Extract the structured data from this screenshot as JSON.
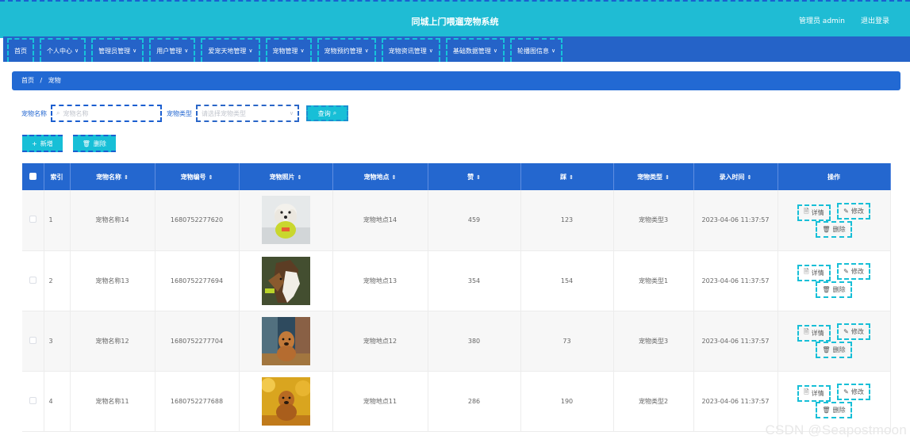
{
  "header": {
    "title": "同城上门喂遛宠物系统",
    "user": "管理员 admin",
    "logout": "退出登录"
  },
  "nav": [
    {
      "label": "首页",
      "has_dropdown": false
    },
    {
      "label": "个人中心",
      "has_dropdown": true
    },
    {
      "label": "管理员管理",
      "has_dropdown": true
    },
    {
      "label": "用户管理",
      "has_dropdown": true
    },
    {
      "label": "爱宠天地管理",
      "has_dropdown": true
    },
    {
      "label": "宠物管理",
      "has_dropdown": true
    },
    {
      "label": "宠物预约管理",
      "has_dropdown": true
    },
    {
      "label": "宠物资讯管理",
      "has_dropdown": true
    },
    {
      "label": "基础数据管理",
      "has_dropdown": true
    },
    {
      "label": "轮播图信息",
      "has_dropdown": true
    }
  ],
  "breadcrumb": {
    "home": "首页",
    "separator": "/",
    "current": "宠物"
  },
  "search": {
    "name_label": "宠物名称",
    "name_placeholder": "宠物名称",
    "type_label": "宠物类型",
    "type_placeholder": "请选择宠物类型",
    "query_label": "查询"
  },
  "actions": {
    "add_label": "新增",
    "delete_label": "删除"
  },
  "table": {
    "headers": {
      "index": "索引",
      "name": "宠物名称",
      "code": "宠物编号",
      "photo": "宠物照片",
      "location": "宠物地点",
      "likes": "赞",
      "dislikes": "踩",
      "type": "宠物类型",
      "time": "录入时间",
      "ops": "操作"
    },
    "rows": [
      {
        "index": "1",
        "name": "宠物名称14",
        "code": "1680752277620",
        "location": "宠物地点14",
        "likes": "459",
        "dislikes": "123",
        "type": "宠物类型3",
        "time": "2023-04-06 11:37:57",
        "photo": "white-dog-photo"
      },
      {
        "index": "2",
        "name": "宠物名称13",
        "code": "1680752277694",
        "location": "宠物地点13",
        "likes": "354",
        "dislikes": "154",
        "type": "宠物类型1",
        "time": "2023-04-06 11:37:57",
        "photo": "collie-dog-photo"
      },
      {
        "index": "3",
        "name": "宠物名称12",
        "code": "1680752277704",
        "location": "宠物地点12",
        "likes": "380",
        "dislikes": "73",
        "type": "宠物类型3",
        "time": "2023-04-06 11:37:57",
        "photo": "brown-dog-photo"
      },
      {
        "index": "4",
        "name": "宠物名称11",
        "code": "1680752277688",
        "location": "宠物地点11",
        "likes": "286",
        "dislikes": "190",
        "type": "宠物类型2",
        "time": "2023-04-06 11:37:57",
        "photo": "golden-dog-photo"
      }
    ],
    "row_actions": {
      "detail": "详情",
      "edit": "修改",
      "delete": "删除"
    }
  },
  "watermark": "CSDN @Seapostmoon",
  "colors": {
    "header": "#1fbcd4",
    "nav": "#2563c8",
    "table_head": "#2467cf",
    "accent": "#17bfd7"
  }
}
